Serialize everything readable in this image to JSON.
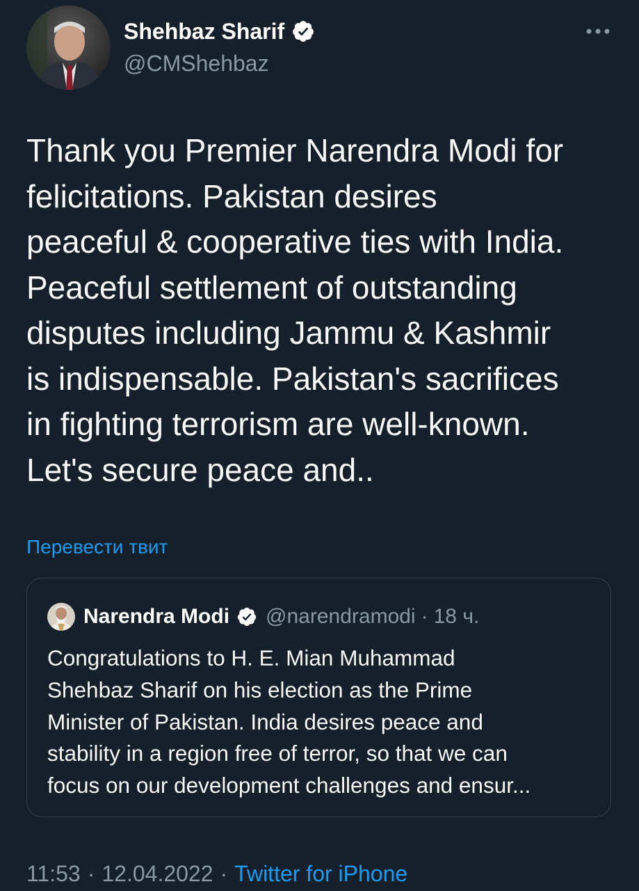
{
  "colors": {
    "background": "#15202b",
    "text": "#f7f9f9",
    "secondary": "#8b98a5",
    "accent": "#1d9bf0",
    "border": "#38444d"
  },
  "tweet": {
    "author_name": "Shehbaz Sharif",
    "author_handle": "@CMShehbaz",
    "avatar_icon": "user-avatar",
    "verified_icon": "verified-badge-icon",
    "more_icon": "more-options-icon",
    "text": "Thank you Premier Narendra Modi for\nfelicitations. Pakistan desires\npeaceful & cooperative ties with India.\nPeaceful settlement of outstanding\ndisputes including Jammu & Kashmir\nis indispensable. Pakistan's sacrifices\nin fighting terrorism are well-known.\nLet's secure peace and..",
    "translate_label": "Перевести твит",
    "time": "11:53",
    "date": "12.04.2022",
    "source": "Twitter for iPhone",
    "separator": "·"
  },
  "quoted_tweet": {
    "author_name": "Narendra Modi",
    "author_handle": "@narendramodi",
    "separator": "·",
    "time_ago": "18 ч.",
    "text": "Congratulations to H. E. Mian Muhammad\nShehbaz Sharif on his election as the Prime\nMinister of Pakistan. India desires peace and\nstability in a region free of terror, so that we can\nfocus on our development challenges and ensur..."
  }
}
